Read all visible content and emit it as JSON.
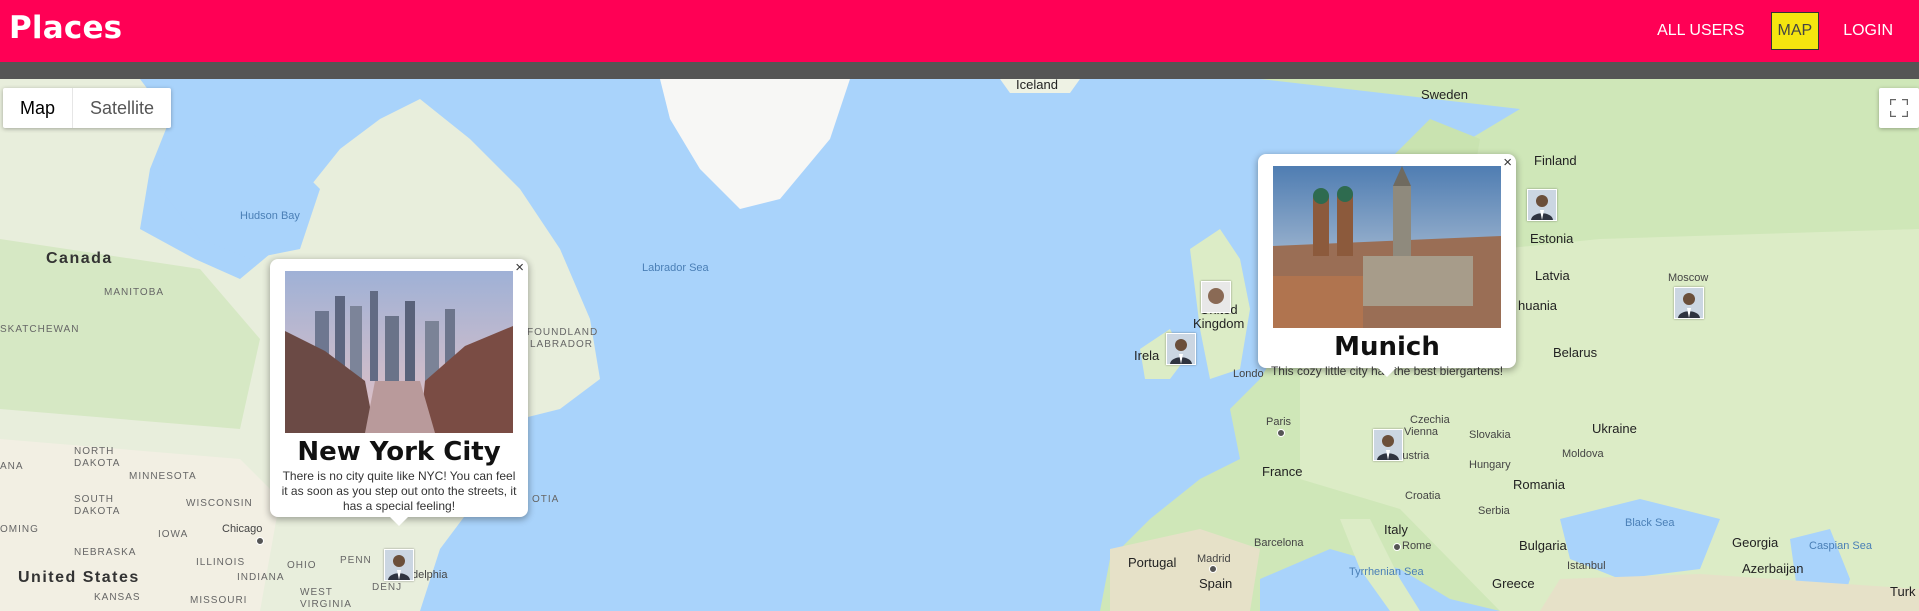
{
  "header": {
    "brand": "Places",
    "nav": [
      {
        "label": "ALL USERS"
      },
      {
        "label": "MAP"
      },
      {
        "label": "LOGIN"
      }
    ],
    "colors": {
      "bar": "#ff0055",
      "active": "#f5e50f",
      "subbar": "#555555"
    }
  },
  "map_controls": {
    "type_map": "Map",
    "type_satellite": "Satellite",
    "fullscreen_icon": "fullscreen-icon"
  },
  "labels": {
    "iceland": "Iceland",
    "sweden": "Sweden",
    "finland": "Finland",
    "estonia": "Estonia",
    "latvia": "Latvia",
    "lithuania": "huania",
    "moscow": "Moscow",
    "belarus": "Belarus",
    "ukraine": "Ukraine",
    "moldova": "Moldova",
    "romania": "Romania",
    "bulgaria": "Bulgaria",
    "black_sea": "Black Sea",
    "georgia": "Georgia",
    "caspian": "Caspian Sea",
    "azerbaijan": "Azerbaijan",
    "turkey": "Turkey",
    "turk": "Turk",
    "greece": "Greece",
    "istanbul": "Istanbul",
    "tyrrhenian": "Tyrrhenian Sea",
    "italy": "Italy",
    "rome": "Rome",
    "serbia": "Serbia",
    "croatia": "Croatia",
    "hungary": "Hungary",
    "slovakia": "Slovakia",
    "vienna": "Vienna",
    "czechia": "Czechia",
    "austria": "Austria",
    "france": "France",
    "paris": "Paris",
    "portugal": "Portugal",
    "spain": "Spain",
    "madrid": "Madrid",
    "barcelona": "Barcelona",
    "london": "Londo",
    "ireland": "Irela",
    "uk1": "United",
    "uk2": "Kingdom",
    "canada": "Canada",
    "hudson_bay": "Hudson Bay",
    "labrador_sea": "Labrador Sea",
    "manitoba": "MANITOBA",
    "saskatchewan": "SKATCHEWAN",
    "foundland": "FOUNDLAND",
    "labrador": "LABRADOR",
    "otia": "OTIA",
    "north_dakota1": "NORTH",
    "north_dakota2": "DAKOTA",
    "minnesota": "MINNESOTA",
    "south_dakota1": "SOUTH",
    "south_dakota2": "DAKOTA",
    "wisconsin": "WISCONSIN",
    "iowa": "IOWA",
    "nebraska": "NEBRASKA",
    "chicago": "Chicago",
    "illinois": "ILLINOIS",
    "indiana": "INDIANA",
    "ohio": "OHIO",
    "penn": "PENN",
    "omi": "OMING",
    "ana": "ANA",
    "united_states": "United States",
    "kansas": "KANSAS",
    "missouri": "MISSOURI",
    "west_virginia1": "WEST",
    "west_virginia2": "VIRGINIA",
    "delphia": "delphia",
    "denj": "DENJ"
  },
  "popups": [
    {
      "title": "New York City",
      "description": "There is no city quite like NYC! You can feel it as soon as you step out onto the streets, it has a special feeling!",
      "close": "×"
    },
    {
      "title": "Munich",
      "description": "This cozy little city has the best biergartens!",
      "close": "×"
    }
  ]
}
